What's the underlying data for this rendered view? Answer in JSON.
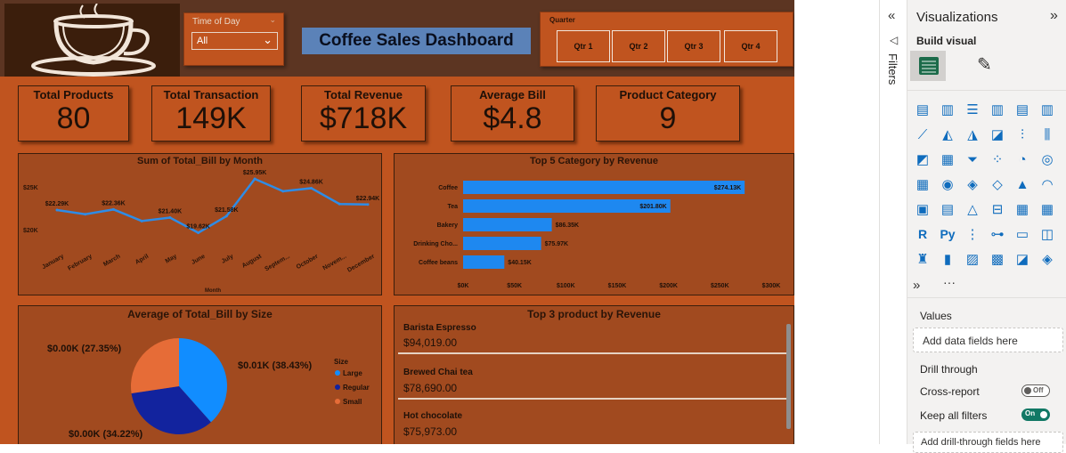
{
  "dashboard": {
    "title": "Coffee Sales Dashboard",
    "time_of_day": {
      "label": "Time of Day",
      "selected": "All"
    },
    "quarter": {
      "label": "Quarter",
      "options": [
        "Qtr 1",
        "Qtr 2",
        "Qtr 3",
        "Qtr 4"
      ]
    },
    "kpis": [
      {
        "title": "Total Products",
        "value": "80"
      },
      {
        "title": "Total Transaction",
        "value": "149K"
      },
      {
        "title": "Total Revenue",
        "value": "$718K"
      },
      {
        "title": "Average Bill",
        "value": "$4.8"
      },
      {
        "title": "Product Category",
        "value": "9"
      }
    ],
    "top3": {
      "title": "Top 3 product by Revenue",
      "items": [
        {
          "name": "Barista Espresso",
          "value": "$94,019.00"
        },
        {
          "name": "Brewed Chai tea",
          "value": "$78,690.00"
        },
        {
          "name": "Hot chocolate",
          "value": "$75,973.00"
        }
      ]
    }
  },
  "chart_data": [
    {
      "type": "line",
      "title": "Sum of Total_Bill by Month",
      "xlabel": "Month",
      "ylabel": "",
      "categories": [
        "January",
        "February",
        "March",
        "April",
        "May",
        "June",
        "July",
        "August",
        "Septem...",
        "October",
        "Novem...",
        "December"
      ],
      "values": [
        22.29,
        21.8,
        22.36,
        21.0,
        21.4,
        19.62,
        21.58,
        25.95,
        24.5,
        24.86,
        23.0,
        22.94
      ],
      "data_labels": [
        "$22.29K",
        "",
        "$22.36K",
        "",
        "$21.40K",
        "$19.62K",
        "$21.58K",
        "$25.95K",
        "",
        "$24.86K",
        "",
        "$22.94K"
      ],
      "y_ticks": [
        "$20K",
        "$25K"
      ],
      "ylim": [
        18,
        27
      ],
      "color": "#2E8CE6"
    },
    {
      "type": "bar",
      "orientation": "horizontal",
      "title": "Top 5 Category by Revenue",
      "categories": [
        "Coffee",
        "Tea",
        "Bakery",
        "Drinking Cho...",
        "Coffee beans"
      ],
      "values": [
        274.13,
        201.8,
        86.35,
        75.97,
        40.15
      ],
      "data_labels": [
        "$274.13K",
        "$201.80K",
        "$86.35K",
        "$75.97K",
        "$40.15K"
      ],
      "x_ticks": [
        "$0K",
        "$50K",
        "$100K",
        "$150K",
        "$200K",
        "$250K",
        "$300K"
      ],
      "xlim": [
        0,
        300
      ],
      "color": "#1E88F0"
    },
    {
      "type": "pie",
      "title": "Average of Total_Bill by Size",
      "legend_title": "Size",
      "categories": [
        "Large",
        "Regular",
        "Small"
      ],
      "values": [
        38.43,
        34.22,
        27.35
      ],
      "data_labels": [
        "$0.01K (38.43%)",
        "$0.00K (34.22%)",
        "$0.00K (27.35%)"
      ],
      "colors": [
        "#118DFF",
        "#12239E",
        "#E66C37"
      ]
    }
  ],
  "pane": {
    "filters_label": "Filters",
    "viz_title": "Visualizations",
    "build_visual": "Build visual",
    "values_label": "Values",
    "add_data": "Add data fields here",
    "drill_through": "Drill through",
    "cross_report": "Cross-report",
    "cross_report_state": "Off",
    "keep_filters": "Keep all filters",
    "keep_filters_state": "On",
    "add_drill": "Add drill-through fields here",
    "more": "···"
  }
}
